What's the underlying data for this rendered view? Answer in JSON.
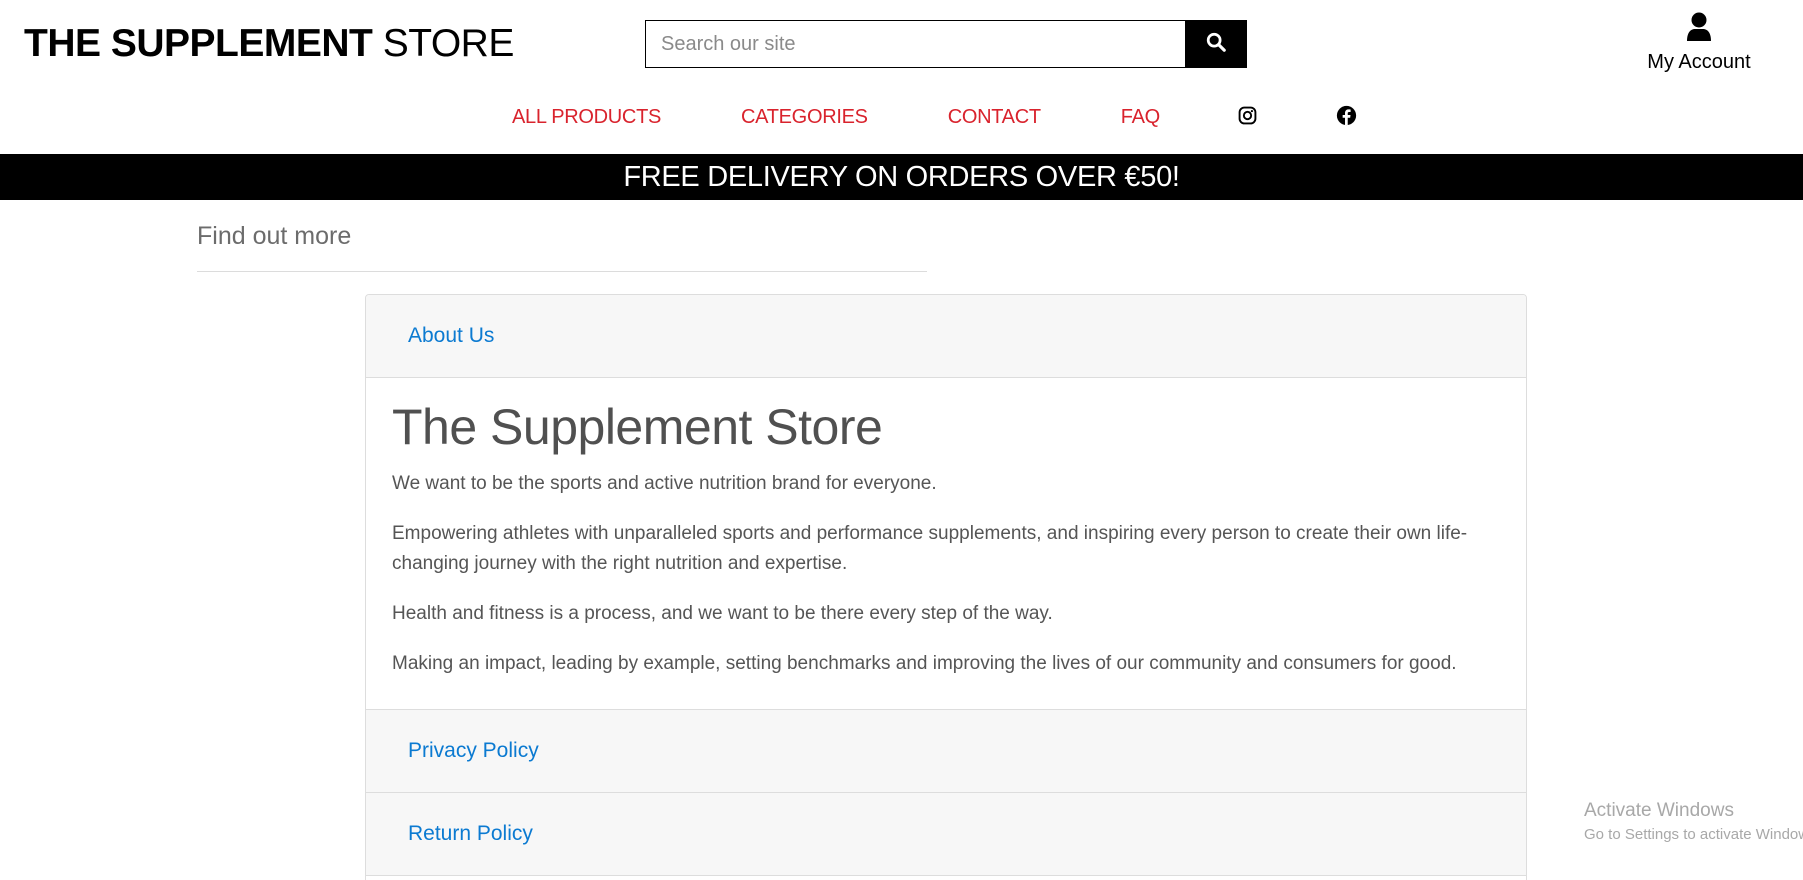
{
  "header": {
    "logo_bold": "THE SUPPLEMENT",
    "logo_light": "STORE",
    "search": {
      "placeholder": "Search our site",
      "value": "",
      "button_icon": "search-icon"
    },
    "account": {
      "icon": "user-icon",
      "label": "My Account"
    }
  },
  "nav": {
    "items": [
      {
        "label": "ALL PRODUCTS"
      },
      {
        "label": "CATEGORIES"
      },
      {
        "label": "CONTACT"
      },
      {
        "label": "FAQ"
      }
    ],
    "social": [
      {
        "icon": "instagram-icon"
      },
      {
        "icon": "facebook-icon"
      }
    ],
    "link_color": "#d9232d"
  },
  "banner": {
    "text": "FREE DELIVERY ON ORDERS OVER €50!"
  },
  "content": {
    "section_title": "Find out more",
    "accordion": {
      "panels": [
        {
          "title": "About Us",
          "expanded": true
        },
        {
          "title": "Privacy Policy",
          "expanded": false
        },
        {
          "title": "Return Policy",
          "expanded": false
        }
      ],
      "about": {
        "heading": "The Supplement Store",
        "paragraphs": [
          "We want to be the sports and active nutrition brand for everyone.",
          "Empowering athletes with unparalleled sports and performance supplements, and inspiring every person to create their own life-changing journey with the right nutrition and expertise.",
          "Health and fitness is a process, and we want to be there every step of the way.",
          "Making an impact, leading by example, setting benchmarks and improving the lives of our community and consumers for good."
        ]
      },
      "link_color": "#0b7ad1"
    }
  },
  "os_watermark": {
    "title": "Activate Windows",
    "subtitle": "Go to Settings to activate Windows."
  }
}
